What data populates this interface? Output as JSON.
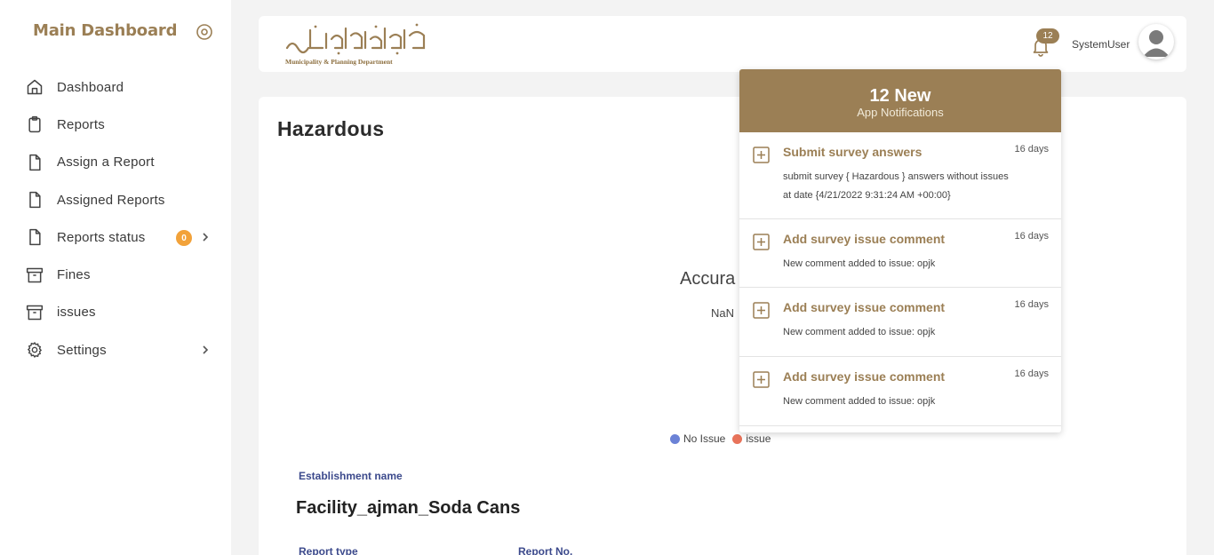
{
  "sidebar": {
    "title": "Main Dashboard",
    "items": [
      {
        "label": "Dashboard",
        "icon": "home-icon"
      },
      {
        "label": "Reports",
        "icon": "clipboard-icon"
      },
      {
        "label": "Assign a Report",
        "icon": "file-icon"
      },
      {
        "label": "Assigned Reports",
        "icon": "file-icon"
      },
      {
        "label": "Reports status",
        "icon": "file-icon",
        "badge": "0"
      },
      {
        "label": "Fines",
        "icon": "archive-icon"
      },
      {
        "label": "issues",
        "icon": "archive-icon"
      },
      {
        "label": "Settings",
        "icon": "gear-icon"
      }
    ]
  },
  "header": {
    "logo_text": "Municipality & Planning Department",
    "notification_count": "12",
    "username": "SystemUser"
  },
  "main": {
    "title": "Hazardous",
    "accuracy_label": "Accura",
    "accuracy_value": "NaN",
    "legend": [
      {
        "label": "No Issue",
        "color": "#6b82d6"
      },
      {
        "label": "issue",
        "color": "#e8735a"
      }
    ],
    "establishment_label": "Establishment name",
    "establishment_value": "Facility_ajman_Soda Cans",
    "report_type_label": "Report type",
    "report_no_label": "Report No."
  },
  "notifications": {
    "count_label": "12 New",
    "subtitle": "App Notifications",
    "items": [
      {
        "title": "Submit survey answers",
        "time": "16 days",
        "body": "submit survey { Hazardous } answers without issues",
        "body2": "at date {4/21/2022 9:31:24 AM +00:00}"
      },
      {
        "title": "Add survey issue comment",
        "time": "16 days",
        "body": "New comment added to issue: opjk"
      },
      {
        "title": "Add survey issue comment",
        "time": "16 days",
        "body": "New comment added to issue: opjk"
      },
      {
        "title": "Add survey issue comment",
        "time": "16 days",
        "body": "New comment added to issue: opjk"
      }
    ]
  },
  "colors": {
    "accent": "#9b7f55",
    "badge_orange": "#f2a23a",
    "label_blue": "#3c4a8c"
  }
}
